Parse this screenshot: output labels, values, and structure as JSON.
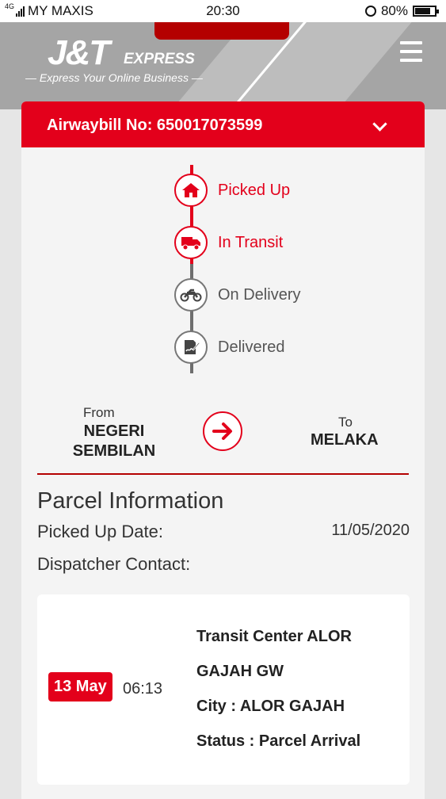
{
  "status_bar": {
    "network": "4G",
    "carrier": "MY MAXIS",
    "time": "20:30",
    "battery": "80%",
    "battery_level": 0.8
  },
  "header": {
    "logo": "J&T",
    "logo_suffix": "EXPRESS",
    "tagline": "— Express Your Online Business —",
    "menu_icon": "hamburger-icon"
  },
  "airwaybill": {
    "label": "Airwaybill No: 650017073599",
    "toggle_icon": "chevron-down-icon"
  },
  "timeline": {
    "steps": [
      {
        "label": "Picked Up",
        "icon": "home-icon",
        "active": true
      },
      {
        "label": "In Transit",
        "icon": "truck-icon",
        "active": true
      },
      {
        "label": "On Delivery",
        "icon": "motorcycle-icon",
        "active": false
      },
      {
        "label": "Delivered",
        "icon": "signature-icon",
        "active": false
      }
    ]
  },
  "route": {
    "from_label": "From",
    "from_value_line1": "NEGERI",
    "from_value_line2": "SEMBILAN",
    "arrow_icon": "arrow-right-icon",
    "to_label": "To",
    "to_value": "MELAKA"
  },
  "parcel": {
    "title": "Parcel Information",
    "picked_up_label": "Picked Up Date:",
    "picked_up_value": "11/05/2020",
    "dispatcher_label": "Dispatcher Contact:"
  },
  "events": [
    {
      "date": "13 May",
      "time": "06:13",
      "line1": "Transit Center ALOR",
      "line2": "GAJAH GW",
      "line3": "City : ALOR GAJAH",
      "line4": "Status : Parcel Arrival"
    }
  ],
  "colors": {
    "brand_red": "#e3001b",
    "header_gray": "#a5a5a5",
    "inactive_gray": "#777777"
  }
}
